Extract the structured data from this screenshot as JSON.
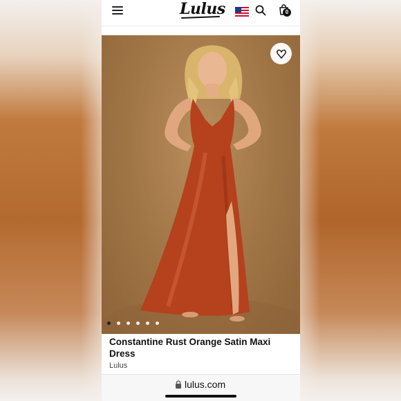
{
  "header": {
    "logo_text": "Lulus",
    "menu_icon": "hamburger-menu-icon",
    "flag_icon": "us-flag-icon",
    "search_icon": "search-icon",
    "bag_icon": "shopping-bag-icon",
    "bag_count": "0"
  },
  "product": {
    "title": "Constantine Rust Orange Satin Maxi Dress",
    "brand": "Lulus",
    "wishlist_icon": "heart-icon",
    "carousel": {
      "total_slides": 6,
      "active_index": 0
    }
  },
  "browser": {
    "url": "lulus.com",
    "lock_icon": "lock-icon"
  },
  "colors": {
    "dress": "#b5411d",
    "backdrop": "#a47a4b",
    "text": "#111111"
  }
}
